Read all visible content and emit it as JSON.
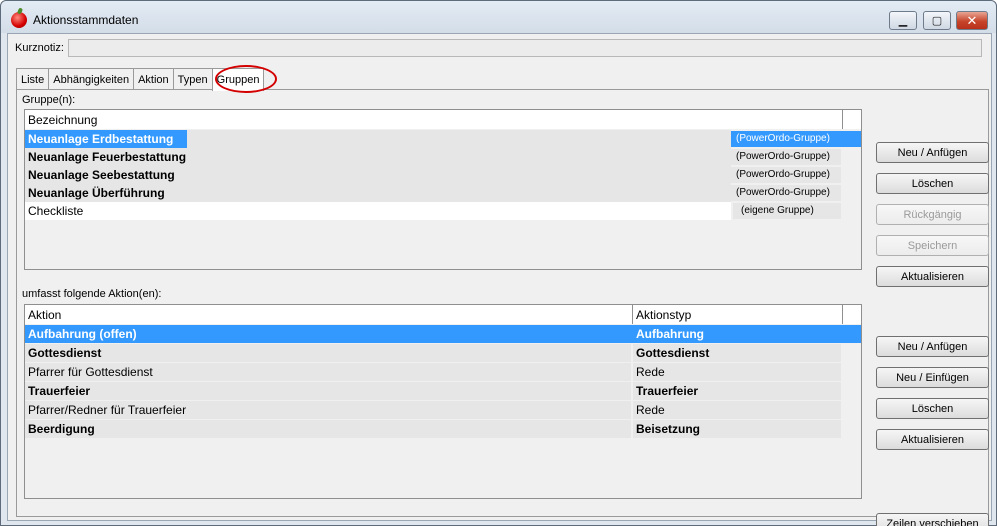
{
  "window": {
    "title": "Aktionsstammdaten",
    "minimize_glyph": "▁",
    "maximize_glyph": "▢",
    "close_glyph": "✕"
  },
  "kurznotiz": {
    "label": "Kurznotiz:",
    "value": ""
  },
  "tabs": [
    {
      "label": "Liste",
      "active": false
    },
    {
      "label": "Abhängigkeiten",
      "active": false
    },
    {
      "label": "Aktion",
      "active": false
    },
    {
      "label": "Typen",
      "active": false
    },
    {
      "label": "Gruppen",
      "active": true
    }
  ],
  "groups": {
    "section_label": "Gruppe(n):",
    "column_header": "Bezeichnung",
    "rows": [
      {
        "name": "Neuanlage Erdbestattung",
        "type": "(PowerOrdo-Gruppe)",
        "selected": true,
        "bold": true
      },
      {
        "name": "Neuanlage Feuerbestattung",
        "type": "(PowerOrdo-Gruppe)",
        "selected": false,
        "bold": true
      },
      {
        "name": "Neuanlage Seebestattung",
        "type": "(PowerOrdo-Gruppe)",
        "selected": false,
        "bold": true
      },
      {
        "name": "Neuanlage Überführung",
        "type": "(PowerOrdo-Gruppe)",
        "selected": false,
        "bold": true
      },
      {
        "name": "Checkliste",
        "type": "(eigene Gruppe)",
        "selected": false,
        "bold": false
      }
    ],
    "buttons": {
      "new": "Neu / Anfügen",
      "delete": "Löschen",
      "undo": "Rückgängig",
      "save": "Speichern",
      "refresh": "Aktualisieren"
    }
  },
  "actions": {
    "section_label": "umfasst folgende Aktion(en):",
    "column_headers": {
      "action": "Aktion",
      "type": "Aktionstyp"
    },
    "rows": [
      {
        "action": "Aufbahrung (offen)",
        "type": "Aufbahrung",
        "selected": true,
        "bold": true
      },
      {
        "action": "Gottesdienst",
        "type": "Gottesdienst",
        "selected": false,
        "bold": true
      },
      {
        "action": "Pfarrer für Gottesdienst",
        "type": "Rede",
        "selected": false,
        "bold": false
      },
      {
        "action": "Trauerfeier",
        "type": "Trauerfeier",
        "selected": false,
        "bold": true
      },
      {
        "action": "Pfarrer/Redner für Trauerfeier",
        "type": "Rede",
        "selected": false,
        "bold": false
      },
      {
        "action": "Beerdigung",
        "type": "Beisetzung",
        "selected": false,
        "bold": true
      }
    ],
    "buttons": {
      "new_append": "Neu / Anfügen",
      "new_insert": "Neu / Einfügen",
      "delete": "Löschen",
      "refresh": "Aktualisieren",
      "move_rows": "Zeilen verschieben"
    }
  },
  "colors": {
    "selection": "#3399ff",
    "annotation_circle": "#d40000"
  }
}
